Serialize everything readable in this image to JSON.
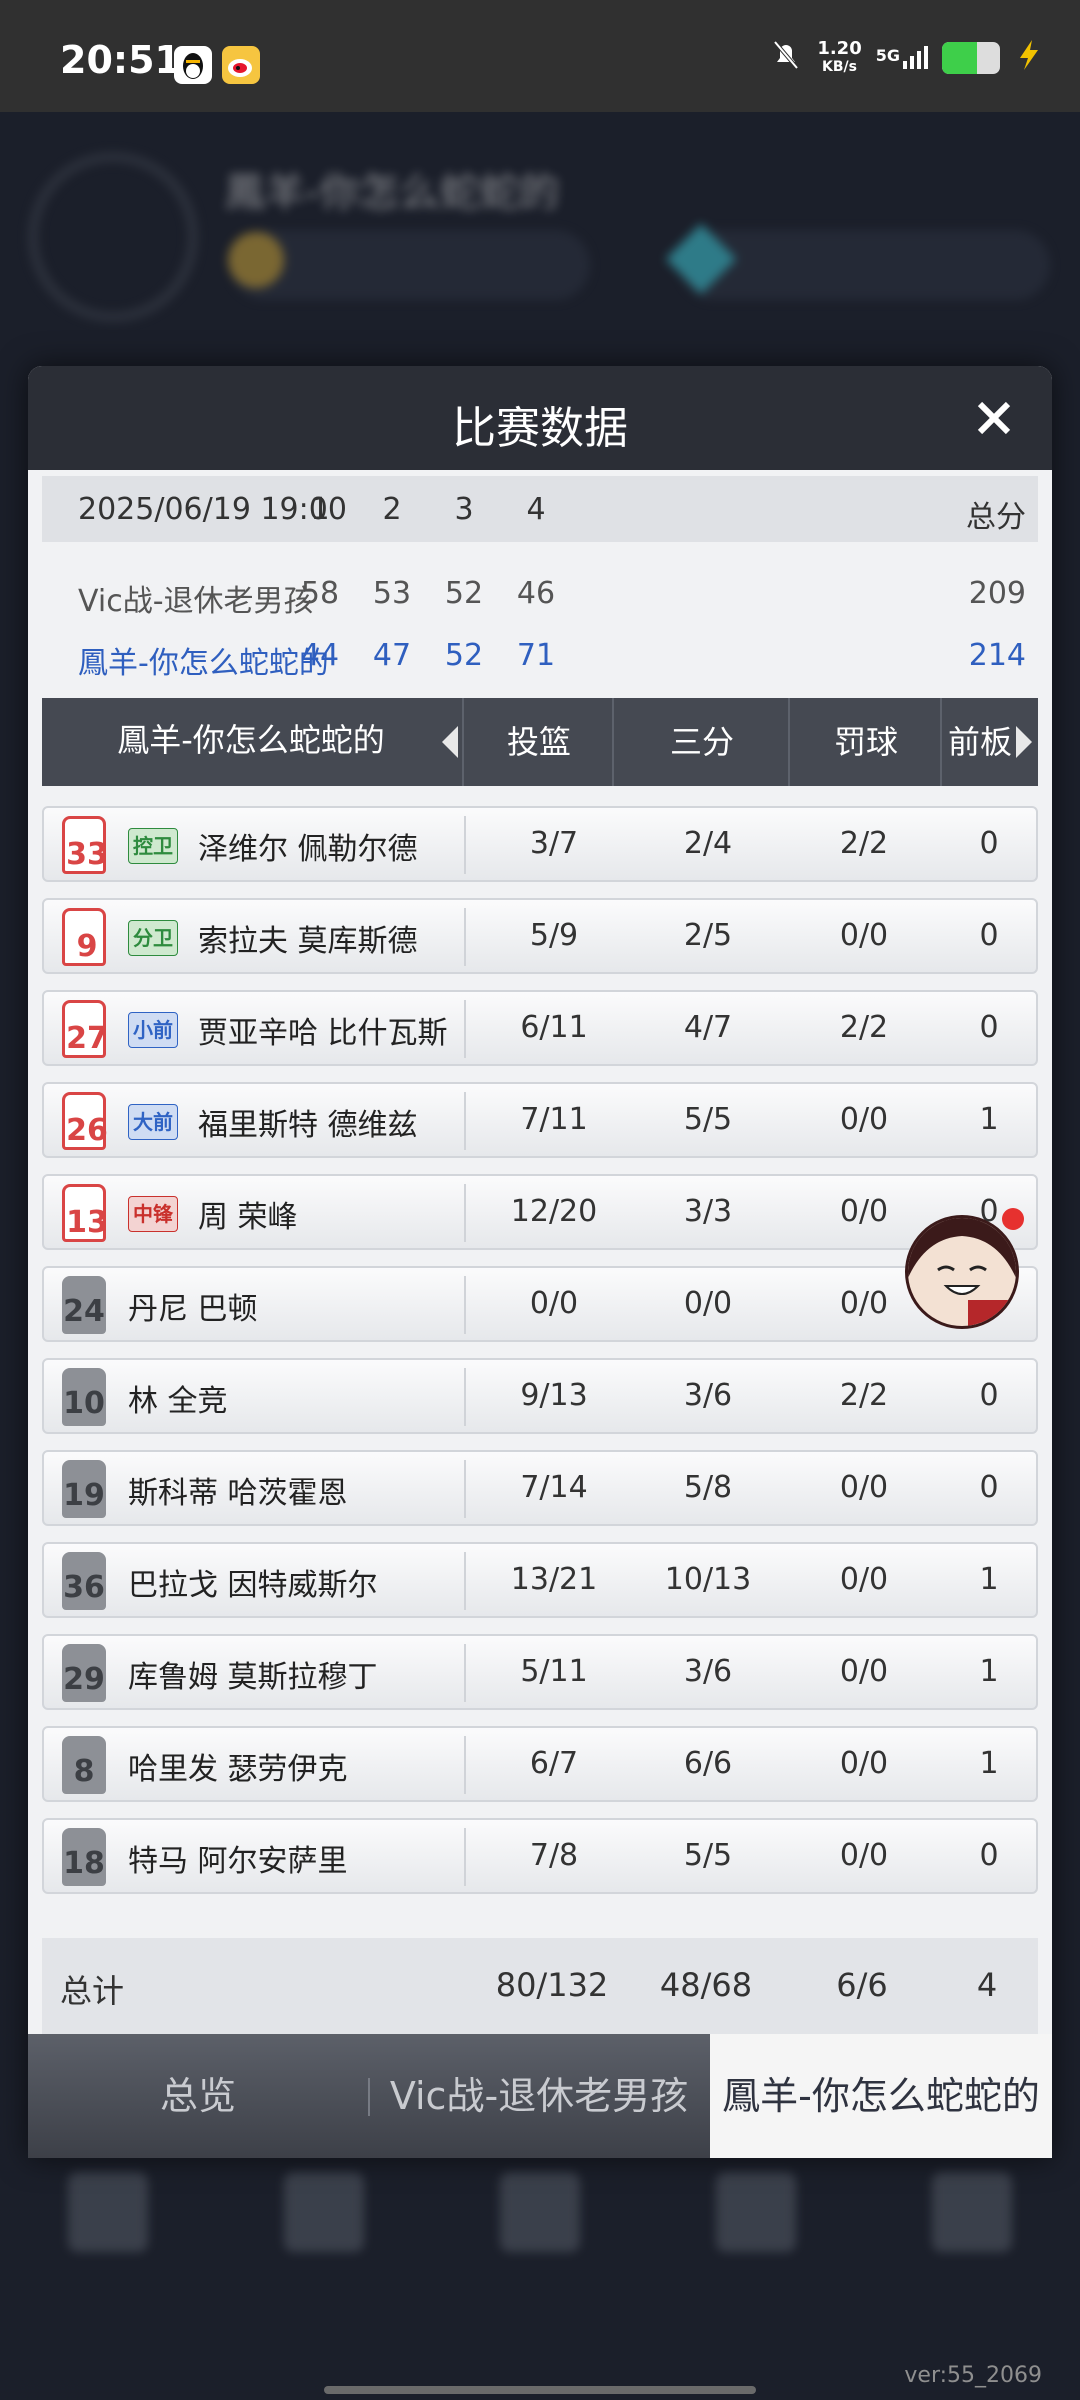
{
  "status_bar": {
    "time": "20:51",
    "net_speed": "1.20",
    "net_unit": "KB/s",
    "signal": "5G"
  },
  "background": {
    "player_name": "鳳羊-你怎么蛇蛇的"
  },
  "modal": {
    "title": "比赛数据",
    "score": {
      "date": "2025/06/19 19:00",
      "headers": [
        "1",
        "2",
        "3",
        "4"
      ],
      "total_label": "总分",
      "team_a": {
        "name": "Vic战-退休老男孩",
        "quarters": [
          "58",
          "53",
          "52",
          "46"
        ],
        "total": "209"
      },
      "team_b": {
        "name": "鳳羊-你怎么蛇蛇的",
        "quarters": [
          "44",
          "47",
          "52",
          "71"
        ],
        "total": "214"
      }
    },
    "table": {
      "team": "鳳羊-你怎么蛇蛇的",
      "columns": [
        "投篮",
        "三分",
        "罚球",
        "前板"
      ],
      "players": [
        {
          "number": "33",
          "position": "控卫",
          "name": "泽维尔 佩勒尔德",
          "fg": "3/7",
          "three": "2/4",
          "ft": "2/2",
          "oreb": "0"
        },
        {
          "number": "9",
          "position": "分卫",
          "name": "索拉夫 莫库斯德",
          "fg": "5/9",
          "three": "2/5",
          "ft": "0/0",
          "oreb": "0"
        },
        {
          "number": "27",
          "position": "小前",
          "name": "贾亚辛哈 比什瓦斯",
          "fg": "6/11",
          "three": "4/7",
          "ft": "2/2",
          "oreb": "0"
        },
        {
          "number": "26",
          "position": "大前",
          "name": "福里斯特 德维兹",
          "fg": "7/11",
          "three": "5/5",
          "ft": "0/0",
          "oreb": "1"
        },
        {
          "number": "13",
          "position": "中锋",
          "name": "周 荣峰",
          "fg": "12/20",
          "three": "3/3",
          "ft": "0/0",
          "oreb": "0"
        },
        {
          "number": "24",
          "position": "",
          "name": "丹尼 巴顿",
          "fg": "0/0",
          "three": "0/0",
          "ft": "0/0",
          "oreb": ""
        },
        {
          "number": "10",
          "position": "",
          "name": "林 全竞",
          "fg": "9/13",
          "three": "3/6",
          "ft": "2/2",
          "oreb": "0"
        },
        {
          "number": "19",
          "position": "",
          "name": "斯科蒂 哈茨霍恩",
          "fg": "7/14",
          "three": "5/8",
          "ft": "0/0",
          "oreb": "0"
        },
        {
          "number": "36",
          "position": "",
          "name": "巴拉戈 因特威斯尔",
          "fg": "13/21",
          "three": "10/13",
          "ft": "0/0",
          "oreb": "1"
        },
        {
          "number": "29",
          "position": "",
          "name": "库鲁姆 莫斯拉穆丁",
          "fg": "5/11",
          "three": "3/6",
          "ft": "0/0",
          "oreb": "1"
        },
        {
          "number": "8",
          "position": "",
          "name": "哈里发 瑟劳伊克",
          "fg": "6/7",
          "three": "6/6",
          "ft": "0/0",
          "oreb": "1"
        },
        {
          "number": "18",
          "position": "",
          "name": "特马 阿尔安萨里",
          "fg": "7/8",
          "three": "5/5",
          "ft": "0/0",
          "oreb": "0"
        }
      ],
      "totals": {
        "label": "总计",
        "fg": "80/132",
        "three": "48/68",
        "ft": "6/6",
        "oreb": "4"
      }
    },
    "bottom_tabs": [
      "总览",
      "Vic战-退休老男孩",
      "鳳羊-你怎么蛇蛇的"
    ],
    "active_tab": 2
  },
  "version": "ver:55_2069",
  "colors": {
    "header_bg": "#2b2e36",
    "team_b_blue": "#2f5fbf",
    "pos_green": "#2e8b3e",
    "pos_blue": "#2f63c4",
    "pos_red": "#c9302c"
  }
}
